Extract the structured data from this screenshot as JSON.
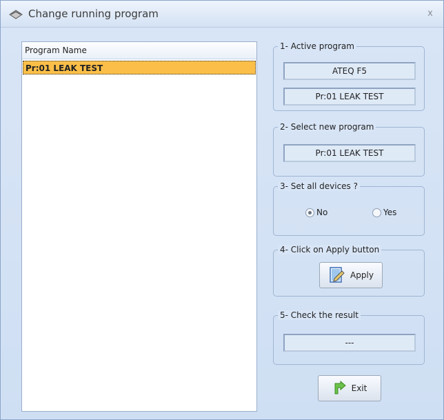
{
  "window": {
    "title": "Change running program",
    "close_label": "x"
  },
  "program_list": {
    "column_header": "Program Name",
    "rows": [
      "Pr:01  LEAK TEST"
    ]
  },
  "active_program": {
    "legend": "1- Active program",
    "device": "ATEQ F5",
    "program": "Pr:01  LEAK TEST"
  },
  "select_new": {
    "legend": "2- Select new program",
    "program": "Pr:01  LEAK TEST"
  },
  "set_all": {
    "legend": "3- Set all devices ?",
    "no_label": "No",
    "yes_label": "Yes",
    "selected": "No"
  },
  "apply_step": {
    "legend": "4- Click on Apply button",
    "button_label": "Apply",
    "icon": "apply-document-icon"
  },
  "result": {
    "legend": "5- Check the result",
    "value": "---"
  },
  "exit_button": {
    "label": "Exit",
    "icon": "exit-arrow-icon"
  }
}
